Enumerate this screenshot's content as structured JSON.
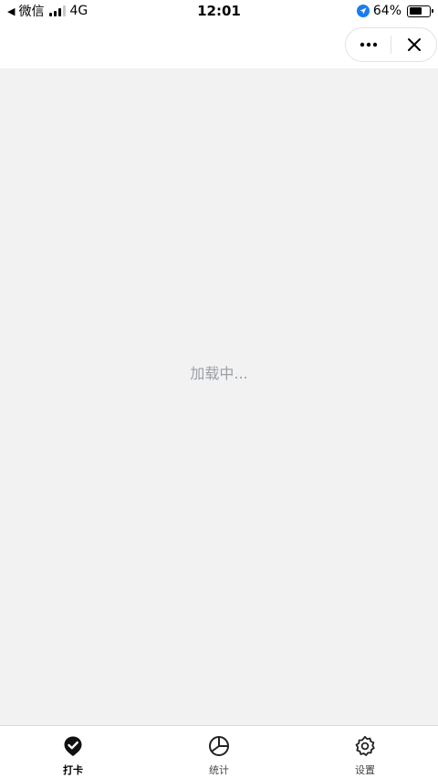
{
  "status_bar": {
    "back_label": "微信",
    "network": "4G",
    "time": "12:01",
    "battery_percent": "64%",
    "battery_level": 0.64
  },
  "nav": {
    "more_icon": "more-dots-icon",
    "close_icon": "close-icon"
  },
  "main": {
    "loading_text": "加载中..."
  },
  "tab_bar": {
    "items": [
      {
        "label": "打卡",
        "icon": "check-badge-icon",
        "active": true
      },
      {
        "label": "统计",
        "icon": "pie-chart-icon",
        "active": false
      },
      {
        "label": "设置",
        "icon": "gear-icon",
        "active": false
      }
    ]
  },
  "colors": {
    "background": "#f2f2f3",
    "loading_text": "#9aa0a6",
    "location_accent": "#1a7cf0"
  }
}
